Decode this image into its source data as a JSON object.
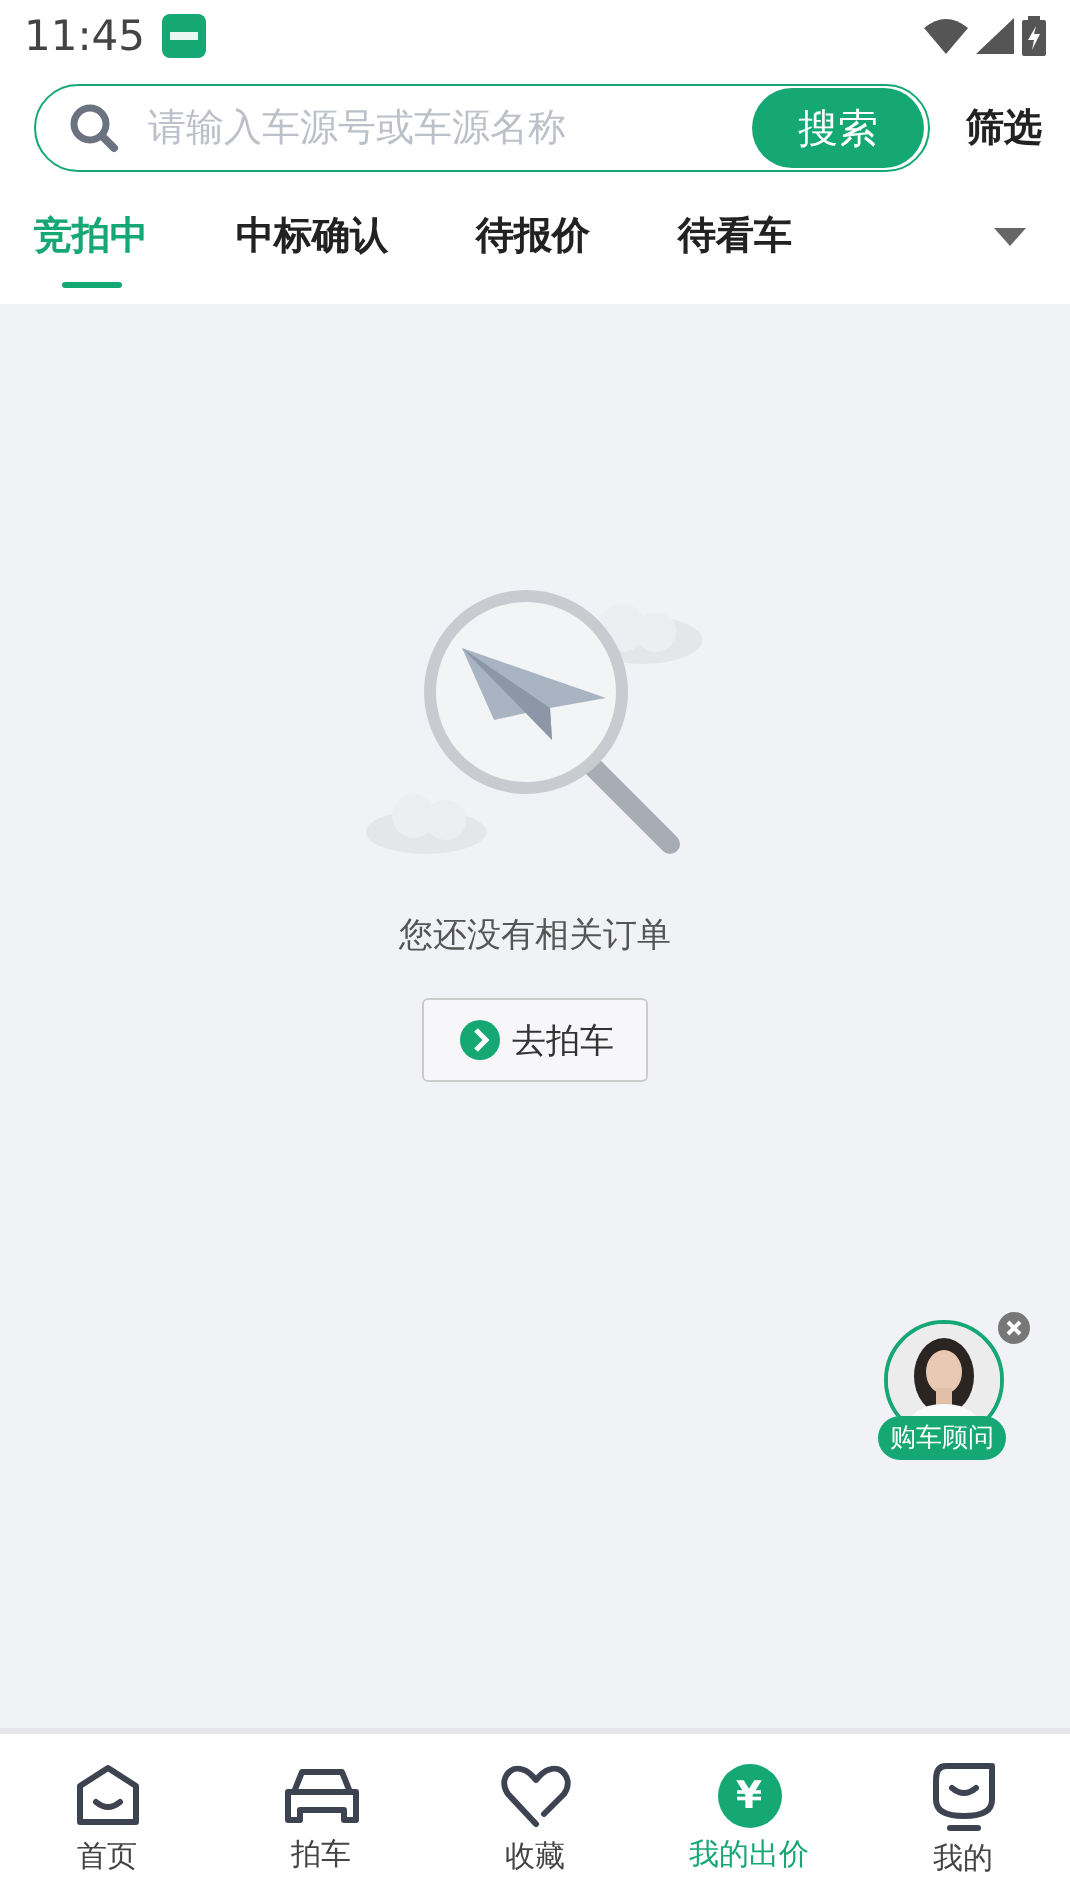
{
  "status_bar": {
    "time": "11:45"
  },
  "search": {
    "placeholder": "请输入车源号或车源名称",
    "button": "搜索",
    "filter": "筛选"
  },
  "tabs": [
    {
      "label": "竞拍中",
      "selected": true
    },
    {
      "label": "中标确认",
      "selected": false
    },
    {
      "label": "待报价",
      "selected": false
    },
    {
      "label": "待看车",
      "selected": false
    }
  ],
  "empty_state": {
    "message": "您还没有相关订单",
    "action": "去拍车"
  },
  "advisor": {
    "label": "购车顾问"
  },
  "nav": [
    {
      "kind": "home",
      "label": "首页",
      "selected": false
    },
    {
      "kind": "car",
      "label": "拍车",
      "selected": false
    },
    {
      "kind": "heart",
      "label": "收藏",
      "selected": false
    },
    {
      "kind": "bid",
      "label": "我的出价",
      "selected": true,
      "glyph": "¥"
    },
    {
      "kind": "me",
      "label": "我的",
      "selected": false
    }
  ]
}
